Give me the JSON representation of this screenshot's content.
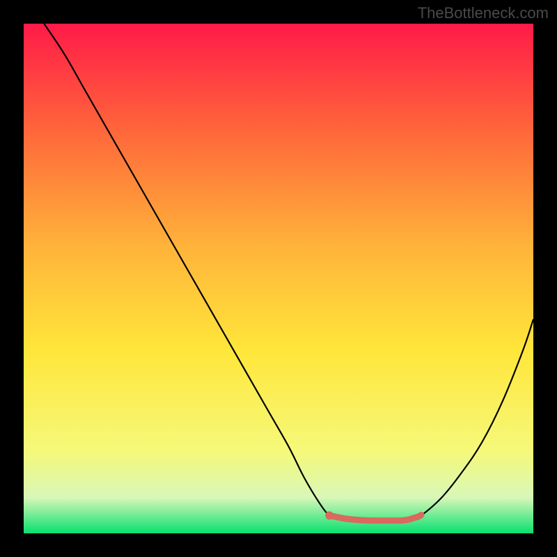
{
  "watermark": "TheBottleneck.com",
  "chart_data": {
    "type": "line",
    "title": "",
    "xlabel": "",
    "ylabel": "",
    "xlim": [
      0,
      100
    ],
    "ylim": [
      0,
      100
    ],
    "grid": false,
    "legend": false,
    "gradient": {
      "top": "#ff1a48",
      "mid1": "#ff6a3a",
      "mid2": "#ffb43a",
      "mid3": "#ffe63a",
      "mid4": "#f5f97a",
      "mid5": "#d8f7b8",
      "bottom": "#08e070"
    },
    "series": [
      {
        "name": "bottleneck-curve",
        "color": "#000000",
        "x": [
          4,
          8,
          12,
          16,
          20,
          24,
          28,
          32,
          36,
          40,
          44,
          48,
          52,
          55,
          58,
          60,
          62,
          64,
          70,
          76,
          78,
          82,
          86,
          90,
          94,
          98,
          100
        ],
        "y": [
          100,
          94,
          87,
          80,
          73,
          66,
          59,
          52,
          45,
          38,
          31,
          24,
          17,
          11,
          6,
          3.5,
          2.7,
          2.5,
          2.5,
          2.6,
          3.5,
          7,
          12,
          18,
          26,
          36,
          42
        ]
      },
      {
        "name": "optimal-zone",
        "color": "#d86a5e",
        "x": [
          60,
          63,
          66,
          69,
          72,
          74,
          75.5,
          76.5,
          77.5,
          78
        ],
        "y": [
          3.5,
          2.9,
          2.6,
          2.5,
          2.5,
          2.5,
          2.7,
          3.0,
          3.3,
          3.6
        ]
      }
    ],
    "optimal_point": {
      "x": 60,
      "y": 3.5,
      "color": "#d86a5e"
    }
  }
}
